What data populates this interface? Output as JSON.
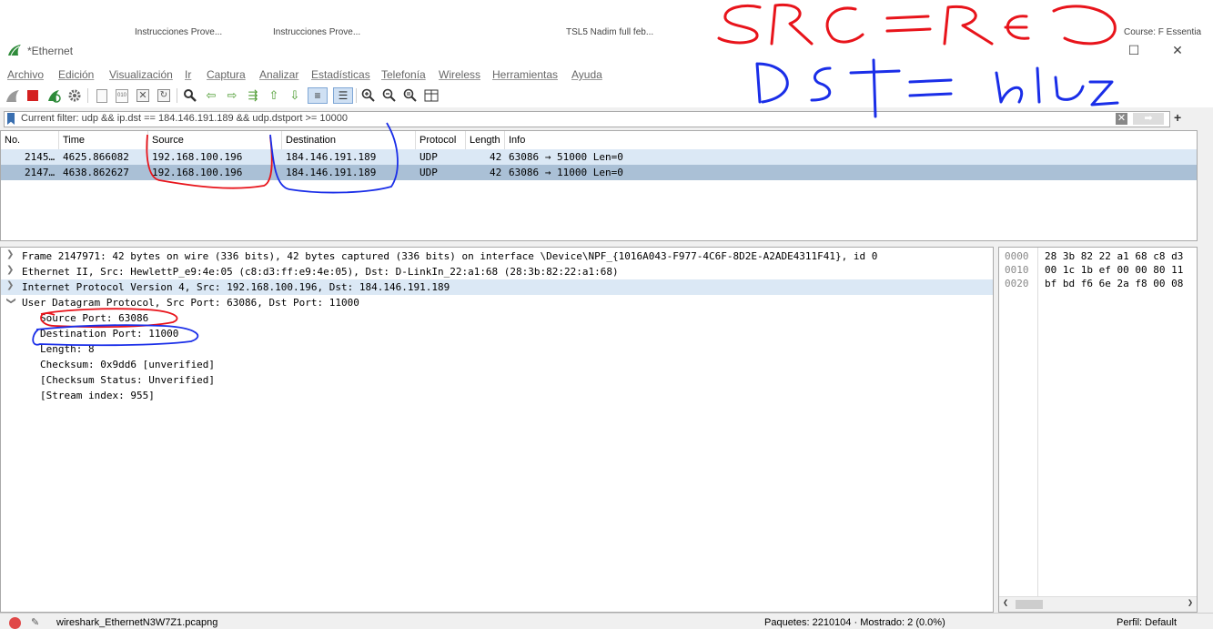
{
  "taskbar_tabs": [
    "Instrucciones Prove...",
    "Instrucciones Prove...",
    "TSL5 Nadim full feb...",
    "Course: F Essentia"
  ],
  "window": {
    "title": "*Ethernet",
    "minimize": "—",
    "maximize": "☐",
    "close": "✕"
  },
  "menu": [
    "Archivo",
    "Edición",
    "Visualización",
    "Ir",
    "Captura",
    "Analizar",
    "Estadísticas",
    "Telefonía",
    "Wireless",
    "Herramientas",
    "Ayuda"
  ],
  "filter": {
    "text": "Current filter: udp && ip.dst == 184.146.191.189 && udp.dstport >= 10000",
    "clear": "✕",
    "apply": "➡",
    "add": "+"
  },
  "packet_list": {
    "columns": {
      "no": "No.",
      "time": "Time",
      "source": "Source",
      "destination": "Destination",
      "protocol": "Protocol",
      "length": "Length",
      "info": "Info"
    },
    "rows": [
      {
        "no": "2145…",
        "time": "4625.866082",
        "source": "192.168.100.196",
        "destination": "184.146.191.189",
        "protocol": "UDP",
        "length": "42",
        "info": "63086 → 51000 Len=0"
      },
      {
        "no": "2147…",
        "time": "4638.862627",
        "source": "192.168.100.196",
        "destination": "184.146.191.189",
        "protocol": "UDP",
        "length": "42",
        "info": "63086 → 11000 Len=0"
      }
    ]
  },
  "details": {
    "frame": "Frame 2147971: 42 bytes on wire (336 bits), 42 bytes captured (336 bits) on interface \\Device\\NPF_{1016A043-F977-4C6F-8D2E-A2ADE4311F41}, id 0",
    "ethernet": "Ethernet II, Src: HewlettP_e9:4e:05 (c8:d3:ff:e9:4e:05), Dst: D-LinkIn_22:a1:68 (28:3b:82:22:a1:68)",
    "ip": "Internet Protocol Version 4, Src: 192.168.100.196, Dst: 184.146.191.189",
    "udp": "User Datagram Protocol, Src Port: 63086, Dst Port: 11000",
    "udp_fields": [
      "Source Port: 63086",
      "Destination Port: 11000",
      "Length: 8",
      "Checksum: 0x9dd6 [unverified]",
      "[Checksum Status: Unverified]",
      "[Stream index: 955]"
    ]
  },
  "bytes": [
    {
      "offset": "0000",
      "hex": "28 3b 82 22 a1 68 c8 d3"
    },
    {
      "offset": "0010",
      "hex": "00 1c 1b ef 00 00 80 11"
    },
    {
      "offset": "0020",
      "hex": "bf bd f6 6e 2a f8 00 08"
    }
  ],
  "status": {
    "file": "wireshark_EthernetN3W7Z1.pcapng",
    "packets": "Paquetes: 2210104 · Mostrado: 2 (0.0%)",
    "profile": "Perfil: Default"
  },
  "colors": {
    "row_selected": "#aac0d6",
    "row_normal": "#dbe8f5",
    "annotation_red": "#e8141b",
    "annotation_blue": "#1a2ee8"
  }
}
